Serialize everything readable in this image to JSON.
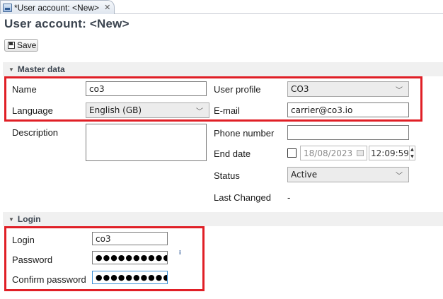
{
  "tab": {
    "title": "*User account: <New>",
    "close_glyph": "✕"
  },
  "page": {
    "title": "User account: <New>"
  },
  "toolbar": {
    "save_label": "Save"
  },
  "master_data": {
    "section_title": "Master data",
    "name_label": "Name",
    "name_value": "co3",
    "language_label": "Language",
    "language_value": "English (GB)",
    "description_label": "Description",
    "description_value": "",
    "user_profile_label": "User profile",
    "user_profile_value": "CO3",
    "email_label": "E-mail",
    "email_value": "carrier@co3.io",
    "phone_label": "Phone number",
    "phone_value": "",
    "end_date_label": "End date",
    "end_date_value": "18/08/2023",
    "end_time_value": "12:09:59",
    "status_label": "Status",
    "status_value": "Active",
    "last_changed_label": "Last Changed",
    "last_changed_value": "-"
  },
  "login": {
    "section_title": "Login",
    "login_label": "Login",
    "login_value": "co3",
    "password_label": "Password",
    "password_value": "●●●●●●●●●●",
    "confirm_label": "Confirm password",
    "confirm_value": "●●●●●●●●●●",
    "info_glyph": "i"
  },
  "icons": {
    "tab": "user-account-icon",
    "save": "save-disk-icon",
    "section_toggle": "collapse-triangle-icon",
    "dropdown": "chevron-down-icon",
    "calendar": "calendar-icon",
    "info": "info-icon"
  },
  "colors": {
    "highlight": "#e01f26",
    "focus": "#3b8fd6",
    "title": "#3c4550"
  }
}
